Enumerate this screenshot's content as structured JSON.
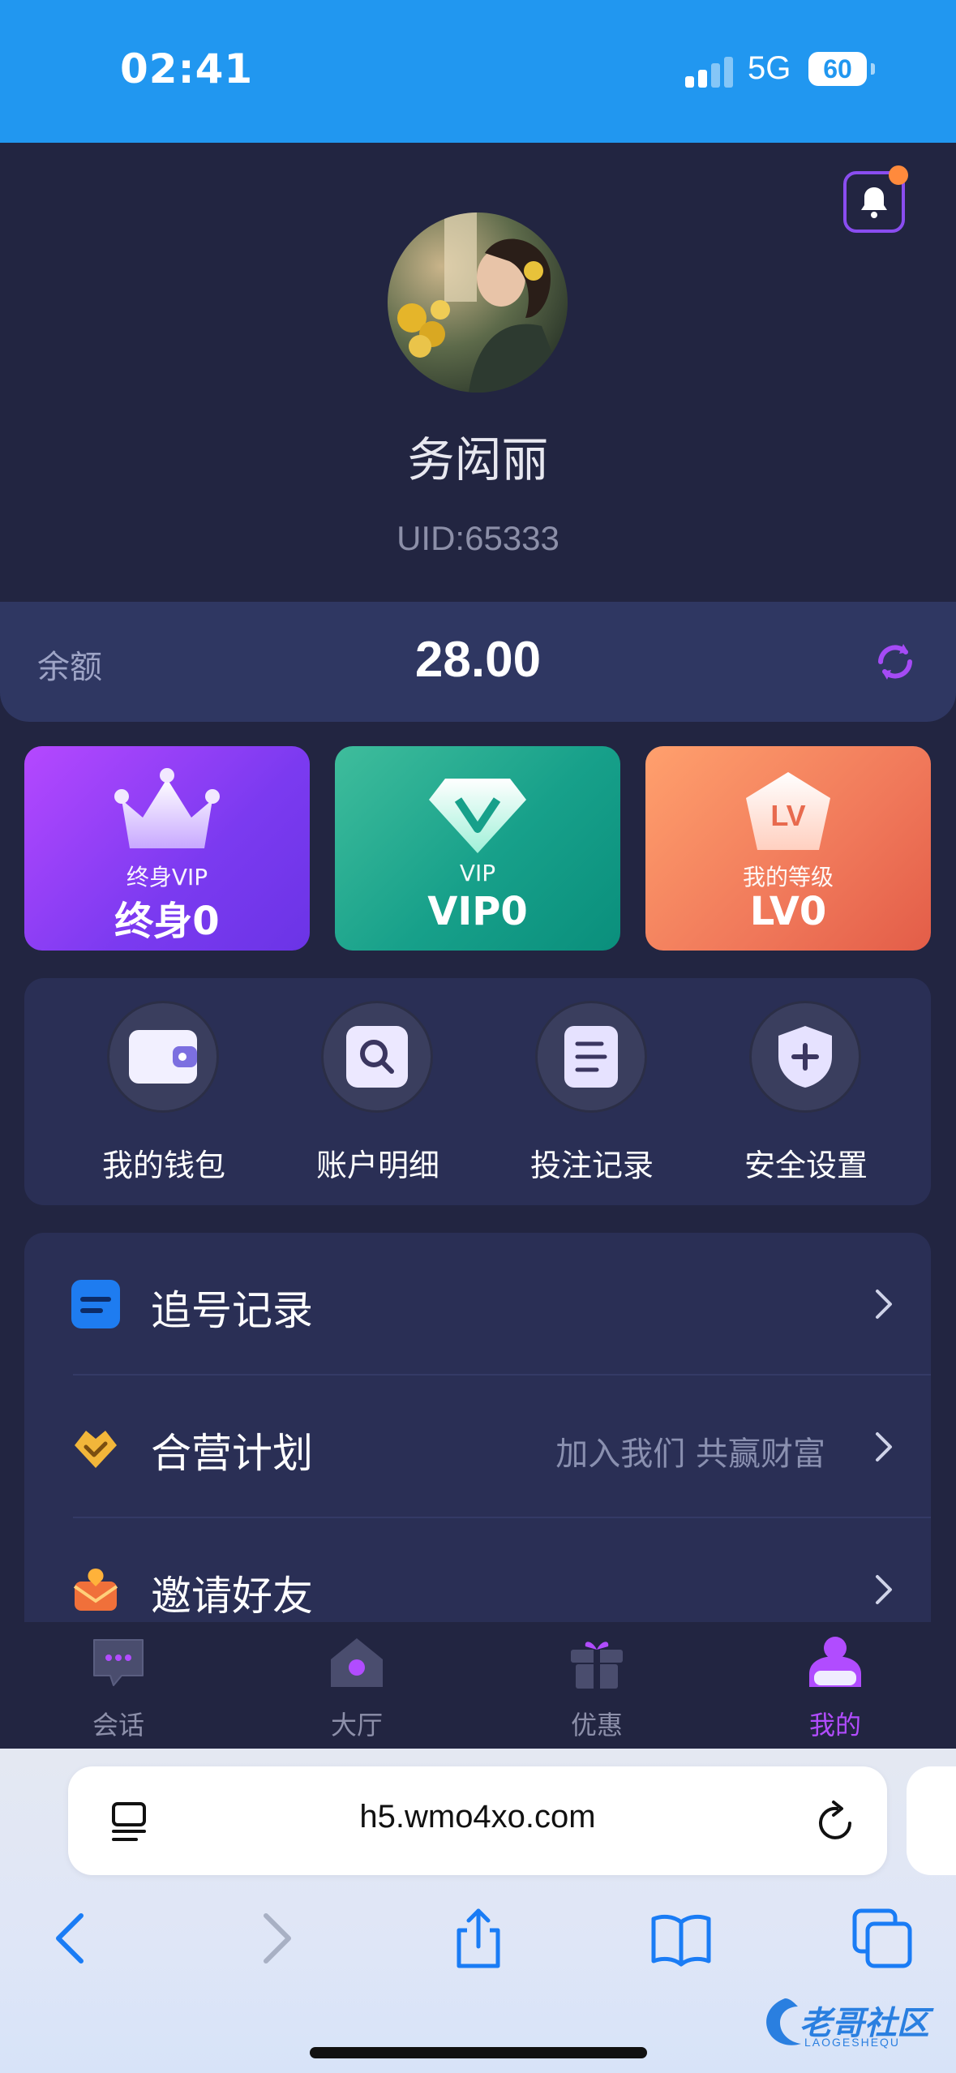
{
  "status_bar": {
    "time": "02:41",
    "network": "5G",
    "battery": "60"
  },
  "profile": {
    "name": "务闳丽",
    "uid": "UID:65333"
  },
  "balance": {
    "label": "余额",
    "value": "28.00"
  },
  "cards": [
    {
      "sub": "终身VIP",
      "main": "终身0"
    },
    {
      "sub": "VIP",
      "main": "VIP0"
    },
    {
      "sub": "我的等级",
      "main": "LV0",
      "badge": "LV"
    }
  ],
  "actions": [
    {
      "label": "我的钱包",
      "icon": "wallet-icon"
    },
    {
      "label": "账户明细",
      "icon": "search-icon"
    },
    {
      "label": "投注记录",
      "icon": "document-icon"
    },
    {
      "label": "安全设置",
      "icon": "shield-icon"
    }
  ],
  "menu": [
    {
      "label": "追号记录",
      "hint": "",
      "icon": "list-icon"
    },
    {
      "label": "合营计划",
      "hint": "加入我们 共赢财富",
      "icon": "handshake-icon"
    },
    {
      "label": "邀请好友",
      "hint": "",
      "icon": "invite-icon"
    }
  ],
  "tabs": [
    {
      "label": "会话",
      "icon": "chat-icon",
      "active": false
    },
    {
      "label": "大厅",
      "icon": "home-icon",
      "active": false
    },
    {
      "label": "优惠",
      "icon": "gift-icon",
      "active": false
    },
    {
      "label": "我的",
      "icon": "profile-icon",
      "active": true
    }
  ],
  "browser": {
    "url": "h5.wmo4xo.com"
  },
  "watermark": {
    "text": "老哥社区",
    "sub": "LAOGESHEQU"
  },
  "colors": {
    "accent": "#b14cff",
    "status_bar": "#2197f0",
    "background": "#222541"
  }
}
